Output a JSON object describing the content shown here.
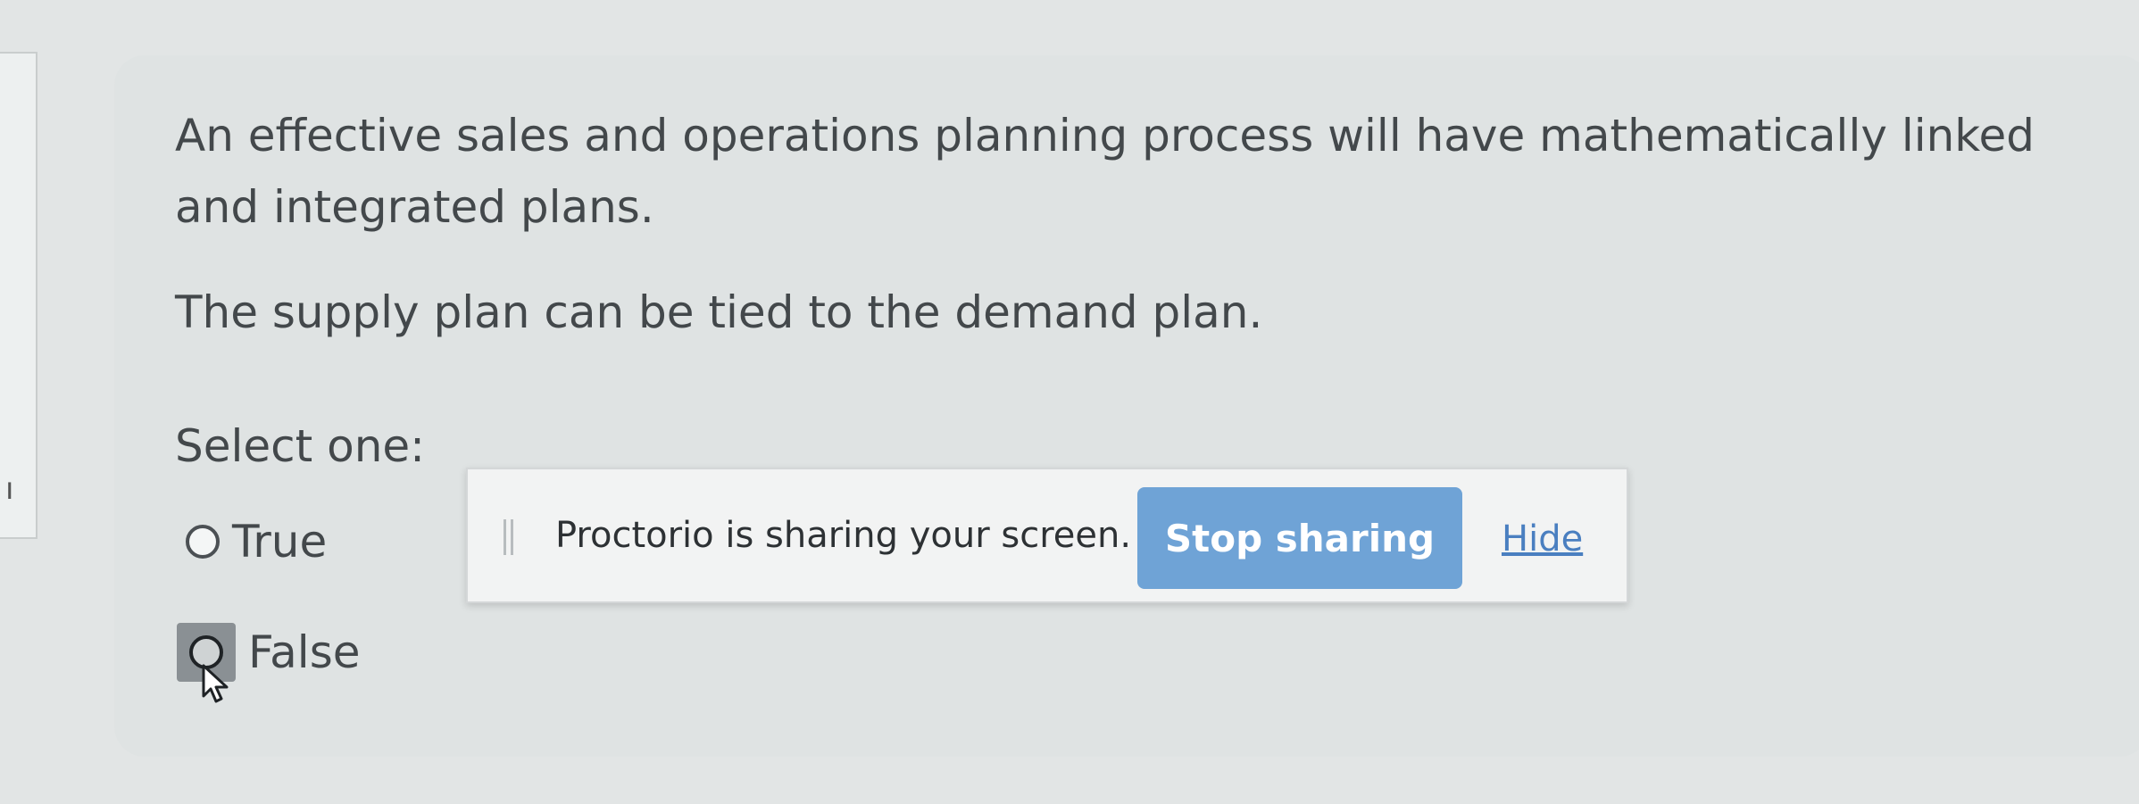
{
  "question": {
    "text": "An effective sales and operations planning process will have mathematically linked and integrated plans.",
    "subtext": "The supply plan can be tied to the demand plan.",
    "select_label": "Select one:",
    "options": [
      {
        "label": "True"
      },
      {
        "label": "False"
      }
    ]
  },
  "left_panel": {
    "glyph": "ı"
  },
  "share_bar": {
    "message": "Proctorio is sharing your screen.",
    "stop_label": "Stop sharing",
    "hide_label": "Hide",
    "accent": "#6fa3d6"
  }
}
